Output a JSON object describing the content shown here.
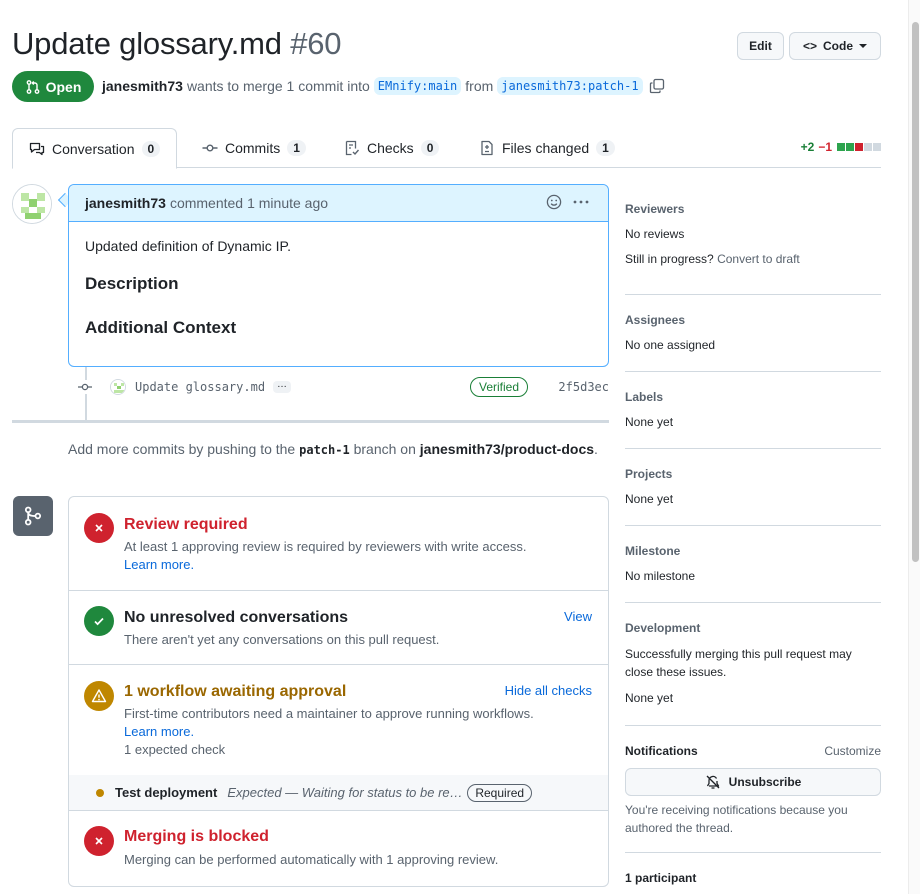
{
  "header": {
    "title": "Update glossary.md",
    "number": "#60",
    "edit_label": "Edit",
    "code_label": "Code"
  },
  "status": {
    "state": "Open",
    "author": "janesmith73",
    "merge_text": "wants to merge 1 commit into",
    "base_branch": "EMnify:main",
    "from_text": "from",
    "head_branch": "janesmith73:patch-1"
  },
  "tabs": [
    {
      "label": "Conversation",
      "count": "0"
    },
    {
      "label": "Commits",
      "count": "1"
    },
    {
      "label": "Checks",
      "count": "0"
    },
    {
      "label": "Files changed",
      "count": "1"
    }
  ],
  "diffstat": {
    "additions": "+2",
    "deletions": "−1"
  },
  "comment": {
    "author": "janesmith73",
    "action": "commented",
    "time": "1 minute ago",
    "body": "Updated definition of Dynamic IP.",
    "heading1": "Description",
    "heading2": "Additional Context"
  },
  "commit": {
    "message": "Update glossary.md",
    "ellipsis": "…",
    "verified": "Verified",
    "sha": "2f5d3ec"
  },
  "push_note": {
    "prefix": "Add more commits by pushing to the",
    "branch": "patch-1",
    "middle": "branch on",
    "repo": "janesmith73/product-docs",
    "suffix": "."
  },
  "merge": {
    "review": {
      "title": "Review required",
      "desc": "At least 1 approving review is required by reviewers with write access.",
      "link": "Learn more."
    },
    "conversations": {
      "title": "No unresolved conversations",
      "desc": "There aren't yet any conversations on this pull request.",
      "action": "View"
    },
    "workflow": {
      "title": "1 workflow awaiting approval",
      "desc": "First-time contributors need a maintainer to approve running workflows.",
      "link": "Learn more.",
      "extra": "1 expected check",
      "action": "Hide all checks"
    },
    "check": {
      "name": "Test deployment",
      "status": "Expected — Waiting for status to be reported",
      "badge": "Required"
    },
    "blocked": {
      "title": "Merging is blocked",
      "desc": "Merging can be performed automatically with 1 approving review."
    }
  },
  "sidebar": {
    "reviewers": {
      "heading": "Reviewers",
      "value": "No reviews",
      "progress": "Still in progress?",
      "convert": "Convert to draft"
    },
    "assignees": {
      "heading": "Assignees",
      "value": "No one assigned"
    },
    "labels": {
      "heading": "Labels",
      "value": "None yet"
    },
    "projects": {
      "heading": "Projects",
      "value": "None yet"
    },
    "milestone": {
      "heading": "Milestone",
      "value": "No milestone"
    },
    "development": {
      "heading": "Development",
      "desc": "Successfully merging this pull request may close these issues.",
      "value": "None yet"
    },
    "notifications": {
      "heading": "Notifications",
      "customize": "Customize",
      "button": "Unsubscribe",
      "desc": "You're receiving notifications because you authored the thread."
    },
    "participants": {
      "heading": "1 participant"
    }
  },
  "colors": {
    "open_green": "#1f883d",
    "danger": "#cf222e",
    "attention": "#9a6700",
    "link": "#0969da"
  }
}
